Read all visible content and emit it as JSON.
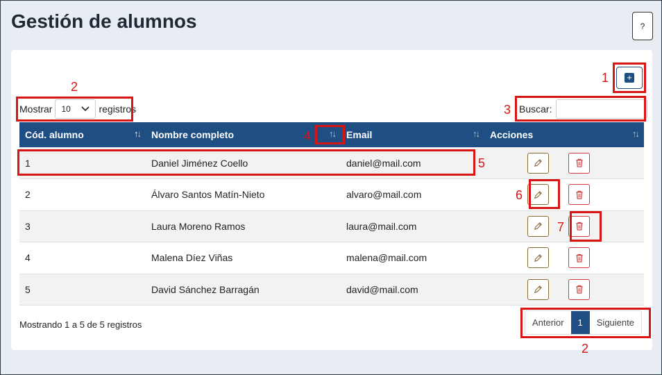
{
  "page": {
    "title": "Gestión de alumnos",
    "help_label": "?"
  },
  "toolbar": {
    "add_label": "+"
  },
  "length": {
    "prefix": "Mostrar",
    "value": "10",
    "suffix": "registros"
  },
  "search": {
    "label": "Buscar:",
    "value": "",
    "placeholder": ""
  },
  "table": {
    "headers": [
      "Cód. alumno",
      "Nombre completo",
      "Email",
      "Acciones"
    ],
    "rows": [
      {
        "id": "1",
        "name": "Daniel Jiménez Coello",
        "email": "daniel@mail.com"
      },
      {
        "id": "2",
        "name": "Álvaro Santos Matín-Nieto",
        "email": "alvaro@mail.com"
      },
      {
        "id": "3",
        "name": "Laura Moreno Ramos",
        "email": "laura@mail.com"
      },
      {
        "id": "4",
        "name": "Malena Díez Viñas",
        "email": "malena@mail.com"
      },
      {
        "id": "5",
        "name": "David Sánchez Barragán",
        "email": "david@mail.com"
      }
    ],
    "row_icons": {
      "edit": "pencil-icon",
      "delete": "trash-icon"
    }
  },
  "footer": {
    "info": "Mostrando 1 a 5 de 5 registros"
  },
  "pagination": {
    "prev": "Anterior",
    "current": "1",
    "next": "Siguiente"
  },
  "annotations": [
    "1",
    "2",
    "3",
    "4",
    "5",
    "6",
    "7",
    "2"
  ],
  "colors": {
    "header": "#1f4e82",
    "annotation": "#d91414",
    "delete": "#d23b3b",
    "edit": "#8a6a3a"
  }
}
